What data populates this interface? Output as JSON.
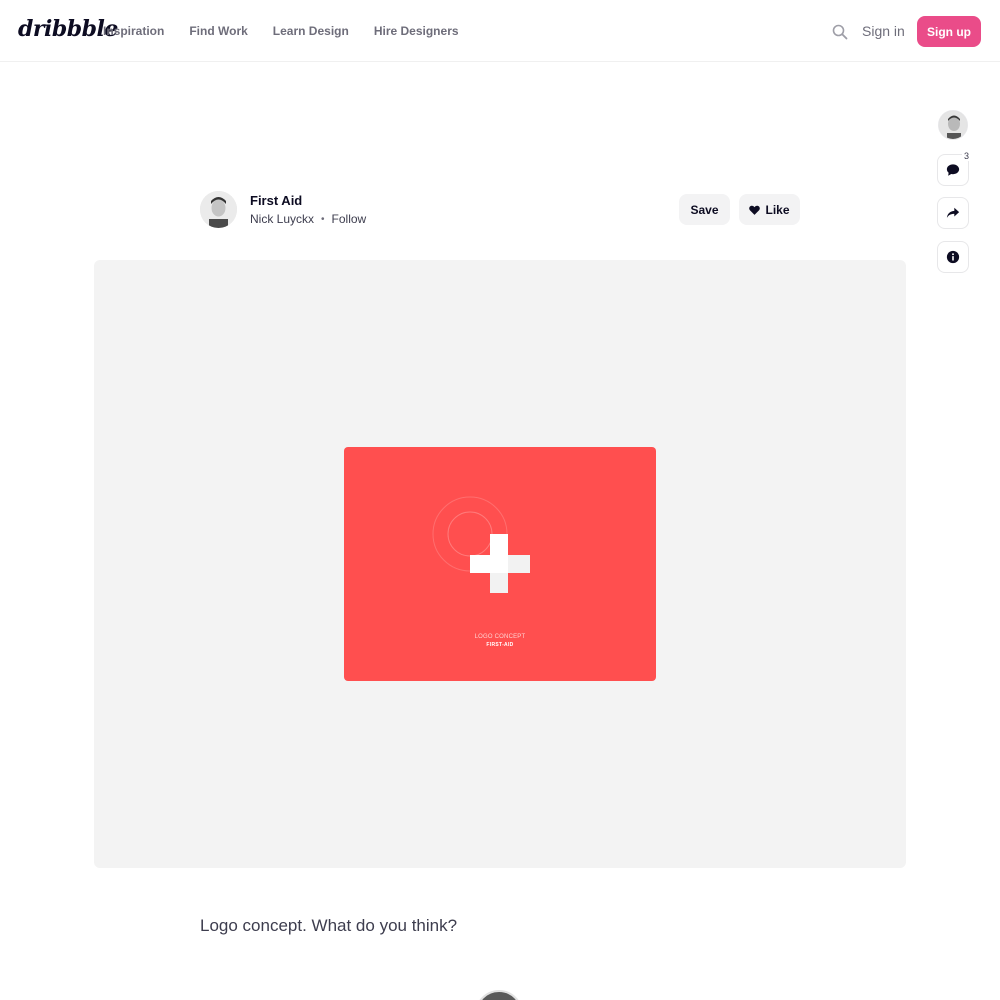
{
  "header": {
    "logo": "dribbble",
    "nav": [
      "Inspiration",
      "Find Work",
      "Learn Design",
      "Hire Designers"
    ],
    "signin_label": "Sign in",
    "signup_label": "Sign up",
    "accent_color": "#ea4c89"
  },
  "rail": {
    "comments_count": "3",
    "icons": [
      "avatar",
      "comment-icon",
      "share-icon",
      "info-icon"
    ]
  },
  "shot": {
    "title": "First Aid",
    "author": "Nick Luyckx",
    "separator": "•",
    "follow_label": "Follow",
    "save_label": "Save",
    "like_label": "Like",
    "card_color": "#ff4f4f",
    "card_line1": "LOGO CONCEPT",
    "card_line2": "FIRST-AID",
    "description": "Logo concept. What do you think?"
  }
}
